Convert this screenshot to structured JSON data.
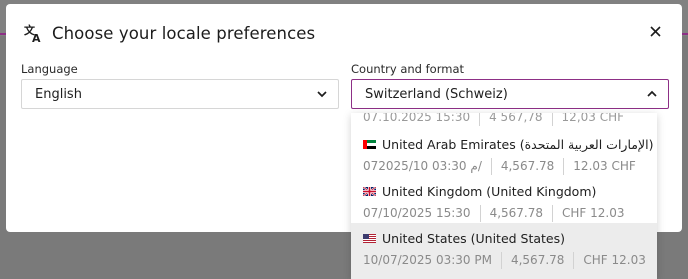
{
  "modal": {
    "title": "Choose your locale preferences",
    "title_icon": "translate-icon",
    "close_icon": "close-icon"
  },
  "language": {
    "label": "Language",
    "value": "English"
  },
  "country": {
    "label": "Country and format",
    "value": "Switzerland (Schweiz)"
  },
  "dropdown": {
    "partial_row": [
      "07.10.2025 15:30",
      "4 567,78",
      "12,03 CHF"
    ],
    "options": [
      {
        "name": "United Arab Emirates (الإمارات العربية المتحدة)",
        "flag": "uae-flag",
        "date": "07م 03:30 2025/10/",
        "number": "4,567.78",
        "currency": "12.03 CHF",
        "highlighted": false
      },
      {
        "name": "United Kingdom (United Kingdom)",
        "flag": "uk-flag",
        "date": "07/10/2025 15:30",
        "number": "4,567.78",
        "currency": "CHF 12.03",
        "highlighted": false
      },
      {
        "name": "United States (United States)",
        "flag": "us-flag",
        "date": "10/07/2025 03:30 PM",
        "number": "4,567.78",
        "currency": "CHF 12.03",
        "highlighted": true
      }
    ]
  },
  "colors": {
    "accent": "#8d2f86",
    "highlight": "#ececec",
    "muted_text": "#8a8a8a"
  }
}
